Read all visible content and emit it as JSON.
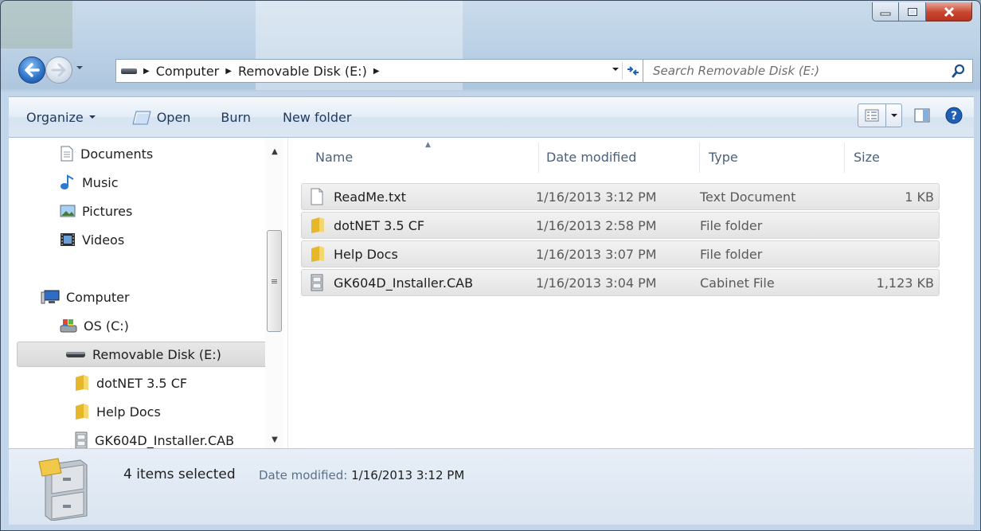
{
  "window": {
    "caption_buttons": [
      "minimize",
      "maximize",
      "close"
    ]
  },
  "address": {
    "breadcrumbs": [
      "Computer",
      "Removable Disk (E:)"
    ],
    "search_placeholder": "Search Removable Disk (E:)"
  },
  "toolbar": {
    "organize": "Organize",
    "open": "Open",
    "burn": "Burn",
    "new_folder": "New folder"
  },
  "nav": {
    "items": [
      {
        "label": "Documents",
        "icon": "document-icon"
      },
      {
        "label": "Music",
        "icon": "music-icon"
      },
      {
        "label": "Pictures",
        "icon": "pictures-icon"
      },
      {
        "label": "Videos",
        "icon": "videos-icon"
      },
      {
        "label": "Computer",
        "icon": "computer-icon"
      },
      {
        "label": "OS (C:)",
        "icon": "drive-c-icon"
      },
      {
        "label": "Removable Disk (E:)",
        "icon": "removable-disk-icon",
        "selected": true
      },
      {
        "label": "dotNET 3.5 CF",
        "icon": "folder-icon"
      },
      {
        "label": "Help Docs",
        "icon": "folder-icon"
      },
      {
        "label": "GK604D_Installer.CAB",
        "icon": "cabinet-icon"
      }
    ]
  },
  "columns": {
    "name": "Name",
    "date": "Date modified",
    "type": "Type",
    "size": "Size"
  },
  "files": [
    {
      "name": "ReadMe.txt",
      "date": "1/16/2013 3:12 PM",
      "type": "Text Document",
      "size": "1 KB",
      "icon": "text-file-icon"
    },
    {
      "name": "dotNET 3.5 CF",
      "date": "1/16/2013 2:58 PM",
      "type": "File folder",
      "size": "",
      "icon": "folder-icon"
    },
    {
      "name": "Help Docs",
      "date": "1/16/2013 3:07 PM",
      "type": "File folder",
      "size": "",
      "icon": "folder-icon"
    },
    {
      "name": "GK604D_Installer.CAB",
      "date": "1/16/2013 3:04 PM",
      "type": "Cabinet File",
      "size": "1,123 KB",
      "icon": "cabinet-icon"
    }
  ],
  "details": {
    "summary": "4 items selected",
    "date_label": "Date modified:",
    "date_value": "1/16/2013 3:12 PM"
  },
  "colors": {
    "accent": "#1e395b",
    "selection": "#e3e3e3"
  }
}
